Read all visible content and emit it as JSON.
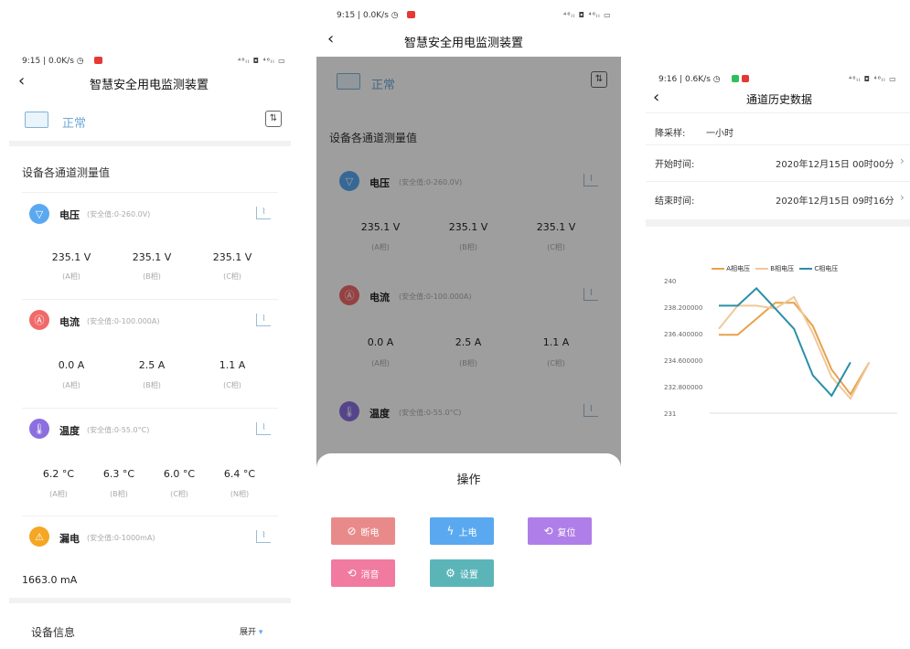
{
  "screen1": {
    "status_left": "9:15 | 0.0K/s ◷",
    "status_right": "⁴⁶ₗₗ ◘ ⁴⁶ₗₗ ▭",
    "title": "智慧安全用电监测装置",
    "status_text": "正常",
    "section_title": "设备各通道测量值",
    "channels": [
      {
        "name": "电压",
        "range": "(安全值:0-260.0V)",
        "icon": "voltage-icon",
        "color": "#5aa9f0",
        "values": [
          {
            "v": "235.1 V",
            "p": "(A相)"
          },
          {
            "v": "235.1 V",
            "p": "(B相)"
          },
          {
            "v": "235.1 V",
            "p": "(C相)"
          }
        ]
      },
      {
        "name": "电流",
        "range": "(安全值:0-100.000A)",
        "icon": "current-icon",
        "color": "#f06a6a",
        "values": [
          {
            "v": "0.0 A",
            "p": "(A相)"
          },
          {
            "v": "2.5 A",
            "p": "(B相)"
          },
          {
            "v": "1.1 A",
            "p": "(C相)"
          }
        ]
      },
      {
        "name": "温度",
        "range": "(安全值:0-55.0°C)",
        "icon": "thermometer-icon",
        "color": "#8b6fe0",
        "values": [
          {
            "v": "6.2 °C",
            "p": "(A相)"
          },
          {
            "v": "6.3 °C",
            "p": "(B相)"
          },
          {
            "v": "6.0 °C",
            "p": "(C相)"
          },
          {
            "v": "6.4 °C",
            "p": "(N相)"
          }
        ]
      },
      {
        "name": "漏电",
        "range": "(安全值:0-1000mA)",
        "icon": "leakage-icon",
        "color": "#f5a623",
        "values": [
          {
            "v": "1663.0 mA",
            "p": ""
          }
        ]
      }
    ],
    "device_info_label": "设备信息",
    "expand_label": "展开"
  },
  "screen2": {
    "status_left": "9:15 | 0.0K/s ◷",
    "status_right": "⁴⁶ₗₗ ◘ ⁴⁶ₗₗ ▭",
    "title": "智慧安全用电监测装置",
    "status_text": "正常",
    "section_title": "设备各通道测量值",
    "channels": [
      {
        "name": "电压",
        "range": "(安全值:0-260.0V)",
        "color": "#5aa9f0",
        "values": [
          {
            "v": "235.1 V",
            "p": "(A相)"
          },
          {
            "v": "235.1 V",
            "p": "(B相)"
          },
          {
            "v": "235.1 V",
            "p": "(C相)"
          }
        ]
      },
      {
        "name": "电流",
        "range": "(安全值:0-100.000A)",
        "color": "#f06a6a",
        "values": [
          {
            "v": "0.0 A",
            "p": "(A相)"
          },
          {
            "v": "2.5 A",
            "p": "(B相)"
          },
          {
            "v": "1.1 A",
            "p": "(C相)"
          }
        ]
      },
      {
        "name": "温度",
        "range": "(安全值:0-55.0°C)",
        "color": "#8b6fe0",
        "values": []
      }
    ],
    "sheet_title": "操作",
    "buttons": [
      {
        "label": "断电",
        "color": "#e98a8a",
        "icon": "power-off-icon",
        "glyph": "⊘"
      },
      {
        "label": "上电",
        "color": "#5aa9f0",
        "icon": "lightning-icon",
        "glyph": "ϟ"
      },
      {
        "label": "复位",
        "color": "#b07ee8",
        "icon": "reset-icon",
        "glyph": "⟲"
      },
      {
        "label": "消音",
        "color": "#f07aa0",
        "icon": "mute-icon",
        "glyph": "⟲"
      },
      {
        "label": "设置",
        "color": "#5bb5b8",
        "icon": "settings-icon",
        "glyph": "⚙"
      }
    ]
  },
  "screen3": {
    "status_left": "9:16 | 0.6K/s ◷",
    "status_right": "⁴⁶ₗₗ ◘ ⁴⁶ₗₗ ▭",
    "title": "通道历史数据",
    "downsample_label": "降采样:",
    "downsample_value": "一小时",
    "start_label": "开始时间:",
    "start_value": "2020年12月15日 00时00分",
    "end_label": "结束时间:",
    "end_value": "2020年12月15日 09时16分",
    "chevron": "›"
  },
  "chart_data": {
    "type": "line",
    "title": "",
    "xlabel": "",
    "ylabel": "",
    "ylim": [
      231,
      240
    ],
    "yticks": [
      "240",
      "238.200000",
      "236.400000",
      "234.600000",
      "232.800000",
      "231"
    ],
    "x": [
      0,
      1,
      2,
      3,
      4,
      5,
      6,
      7,
      8,
      9
    ],
    "series": [
      {
        "name": "A相电压",
        "color": "#e8a24a",
        "values": [
          236.4,
          236.4,
          237.5,
          238.6,
          238.6,
          237.0,
          234.0,
          232.3,
          234.5,
          null
        ]
      },
      {
        "name": "B相电压",
        "color": "#f0c89a",
        "values": [
          236.8,
          238.4,
          238.4,
          238.2,
          239.0,
          236.5,
          233.5,
          232.0,
          234.5,
          null
        ]
      },
      {
        "name": "C相电压",
        "color": "#2a8fa8",
        "values": [
          238.4,
          238.4,
          239.6,
          238.2,
          236.8,
          233.6,
          232.2,
          234.5,
          null,
          null
        ]
      }
    ],
    "legend": "top",
    "grid": false
  }
}
